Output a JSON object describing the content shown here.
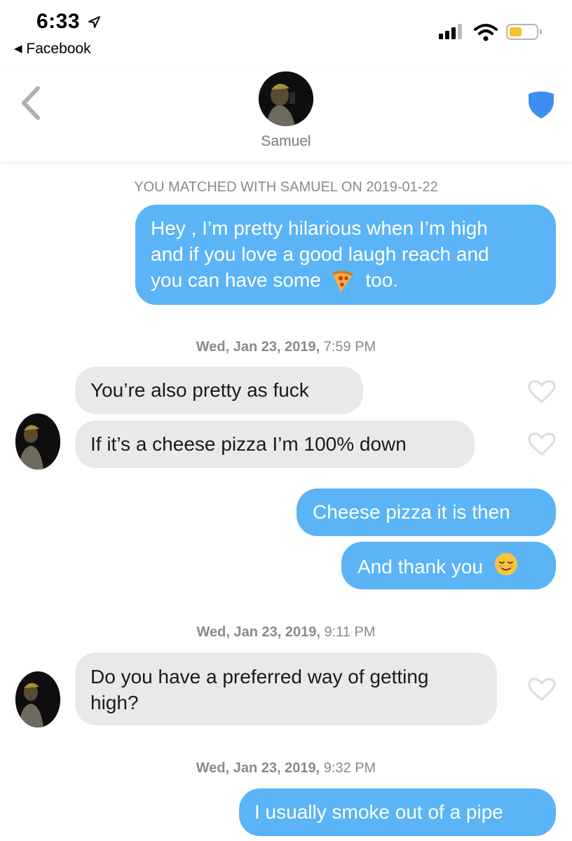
{
  "status": {
    "time": "6:33",
    "back_app": "Facebook"
  },
  "header": {
    "name": "Samuel"
  },
  "chat": {
    "match_notice": "YOU MATCHED WITH SAMUEL ON 2019-01-22",
    "messages": [
      {
        "from": "me",
        "text_a": "Hey , I’m pretty hilarious when I’m high",
        "text_b": "and if you love a good laugh reach and",
        "text_c": "you can have some",
        "text_d": "too."
      },
      {
        "timestamp_day": "Wed, Jan 23, 2019,",
        "timestamp_time": "7:59 PM"
      },
      {
        "from": "samuel",
        "text": "You’re also pretty as fuck"
      },
      {
        "from": "samuel",
        "text": "If it’s a cheese pizza I’m 100%  down"
      },
      {
        "from": "me",
        "text": "Cheese pizza it is then"
      },
      {
        "from": "me",
        "text": "And thank you"
      },
      {
        "timestamp_day": "Wed, Jan 23, 2019,",
        "timestamp_time": "9:11 PM"
      },
      {
        "from": "samuel",
        "text_a": "Do you have a preferred way of getting",
        "text_b": "high?"
      },
      {
        "timestamp_day": "Wed, Jan 23, 2019,",
        "timestamp_time": "9:32 PM"
      },
      {
        "from": "me",
        "text": "I usually smoke out of a pipe"
      }
    ]
  },
  "icons": {
    "location": "location-arrow-icon",
    "signal": "signal-bars-icon",
    "wifi": "wifi-icon",
    "battery": "battery-icon",
    "back": "chevron-left-icon",
    "safety": "shield-icon",
    "pizza": "pizza-emoji",
    "relieved": "relieved-face-emoji",
    "heart": "heart-outline-icon"
  },
  "colors": {
    "outgoing": "#5ab4f6",
    "incoming": "#e9e9eb",
    "shield": "#3d8ef0",
    "battery": "#f3c52a"
  }
}
